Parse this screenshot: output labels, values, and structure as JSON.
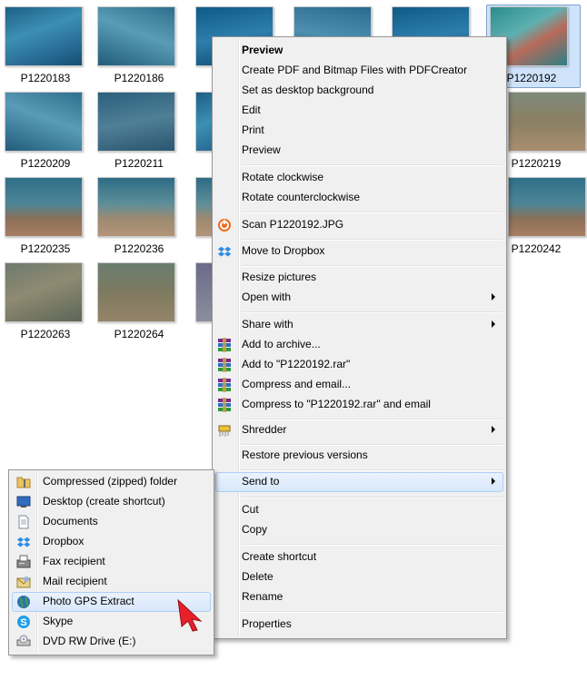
{
  "thumbnails": [
    {
      "name": "P1220183"
    },
    {
      "name": "P1220186"
    },
    {
      "name": ""
    },
    {
      "name": ""
    },
    {
      "name": ""
    },
    {
      "name": "P1220192",
      "selected": true
    },
    {
      "name": "P1220209"
    },
    {
      "name": "P1220211"
    },
    {
      "name": "P1220219"
    },
    {
      "name": "P1220235"
    },
    {
      "name": "P1220236"
    },
    {
      "name": "P1220242"
    },
    {
      "name": "P1220263"
    },
    {
      "name": "P1220264"
    }
  ],
  "context_menu": {
    "preview_bold": "Preview",
    "create_pdf": "Create PDF and Bitmap Files with PDFCreator",
    "set_desktop_bg": "Set as desktop background",
    "edit": "Edit",
    "print": "Print",
    "preview": "Preview",
    "rotate_cw": "Rotate clockwise",
    "rotate_ccw": "Rotate counterclockwise",
    "scan": "Scan P1220192.JPG",
    "move_dropbox": "Move to Dropbox",
    "resize_pictures": "Resize pictures",
    "open_with": "Open with",
    "share_with": "Share with",
    "add_archive": "Add to archive...",
    "add_rar": "Add to \"P1220192.rar\"",
    "compress_email": "Compress and email...",
    "compress_rar_email": "Compress to \"P1220192.rar\" and email",
    "shredder": "Shredder",
    "restore_versions": "Restore previous versions",
    "send_to": "Send to",
    "cut": "Cut",
    "copy": "Copy",
    "create_shortcut": "Create shortcut",
    "delete": "Delete",
    "rename": "Rename",
    "properties": "Properties"
  },
  "send_to_menu": {
    "compressed_folder": "Compressed (zipped) folder",
    "desktop_shortcut": "Desktop (create shortcut)",
    "documents": "Documents",
    "dropbox": "Dropbox",
    "fax_recipient": "Fax recipient",
    "mail_recipient": "Mail recipient",
    "photo_gps_extract": "Photo GPS Extract",
    "skype": "Skype",
    "dvd_drive": "DVD RW Drive (E:)"
  },
  "icons": {
    "scan": "scan-icon",
    "dropbox": "dropbox-icon",
    "winrar": "winrar-icon",
    "shredder": "shredder-icon",
    "zip_folder": "zip-folder-icon",
    "desktop": "desktop-icon",
    "documents": "documents-icon",
    "fax": "fax-icon",
    "mail": "mail-icon",
    "globe": "globe-icon",
    "skype": "skype-icon",
    "dvd": "dvd-drive-icon"
  },
  "colors": {
    "menu_bg": "#f0f0f0",
    "highlight": "#d9e8fb",
    "pointer": "#e8202a"
  }
}
